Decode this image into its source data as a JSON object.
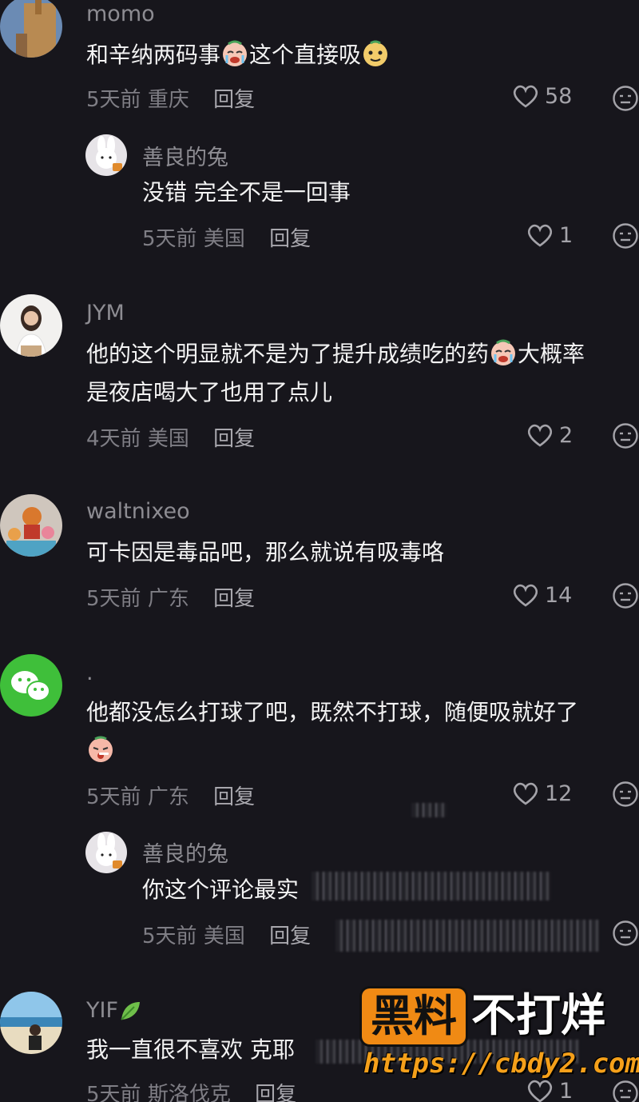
{
  "comments": [
    {
      "username": "momo",
      "text_parts": [
        "和辛纳两码事",
        "这个直接吸"
      ],
      "emojis": [
        "crying-face-emoji",
        "smug-face-emoji"
      ],
      "time": "5天前",
      "location": "重庆",
      "reply_label": "回复",
      "likes": "58"
    },
    {
      "username": "善良的兔",
      "text": "没错 完全不是一回事",
      "time": "5天前",
      "location": "美国",
      "reply_label": "回复",
      "likes": "1"
    },
    {
      "username": "JYM",
      "text_line1_parts": [
        "他的这个明显就不是为了提升成绩吃的药",
        "大概率"
      ],
      "text_line2": "是夜店喝大了也用了点儿",
      "emojis": [
        "crying-face-emoji"
      ],
      "time": "4天前",
      "location": "美国",
      "reply_label": "回复",
      "likes": "2"
    },
    {
      "username": "waltnixeo",
      "text": "可卡因是毒品吧，那么就说有吸毒咯",
      "time": "5天前",
      "location": "广东",
      "reply_label": "回复",
      "likes": "14"
    },
    {
      "username": ".",
      "text": "他都没怎么打球了吧，既然不打球，随便吸就好了",
      "emojis": [
        "sly-face-emoji"
      ],
      "time": "5天前",
      "location": "广东",
      "reply_label": "回复",
      "likes": "12"
    },
    {
      "username": "善良的兔",
      "text": "你这个评论最实",
      "time": "5天前",
      "location": "美国",
      "reply_label": "回复"
    },
    {
      "username": "YIF",
      "text": "我一直很不喜欢 克耶",
      "emojis": [
        "leaf-emoji"
      ],
      "time": "5天前",
      "location": "斯洛伐克",
      "reply_label": "回复",
      "likes": "1"
    }
  ],
  "watermark": {
    "brand": "黑料",
    "slogan": "不打烊",
    "url": "https://cbdy2.com"
  },
  "colors": {
    "background": "#17161c",
    "username": "#8d8c92",
    "text": "#f3f3f3",
    "watermark_orange": "#f08a14"
  }
}
